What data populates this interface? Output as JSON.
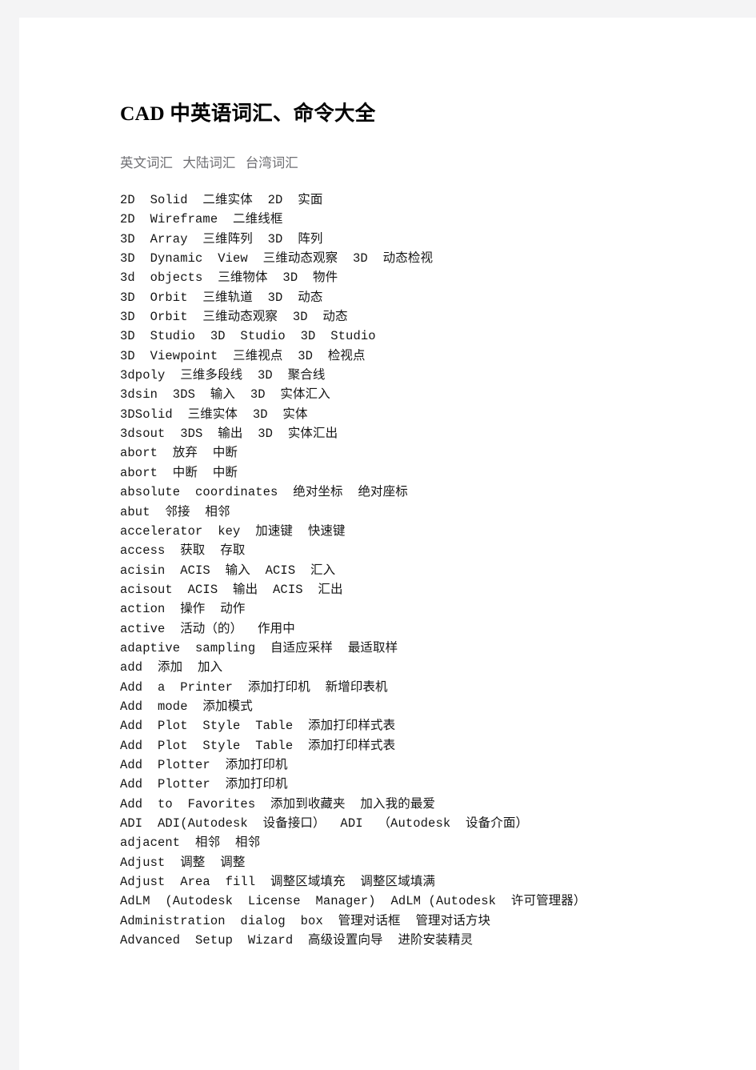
{
  "document": {
    "title": "CAD 中英语词汇、命令大全",
    "column_header": "英文词汇   大陆词汇   台湾词汇",
    "page_background": "#ffffff",
    "margin_background": "#f4f4f5",
    "title_color": "#000000",
    "header_color": "#6e6e72",
    "body_color": "#151515",
    "entries": [
      "2D  Solid  二维实体  2D  实面",
      "2D  Wireframe  二维线框",
      "3D  Array  三维阵列  3D  阵列",
      "3D  Dynamic  View  三维动态观察  3D  动态检视",
      "3d  objects  三维物体  3D  物件",
      "3D  Orbit  三维轨道  3D  动态",
      "3D  Orbit  三维动态观察  3D  动态",
      "3D  Studio  3D  Studio  3D  Studio",
      "3D  Viewpoint  三维视点  3D  检视点",
      "3dpoly  三维多段线  3D  聚合线",
      "3dsin  3DS  输入  3D  实体汇入",
      "3DSolid  三维实体  3D  实体",
      "3dsout  3DS  输出  3D  实体汇出",
      "abort  放弃  中断",
      "abort  中断  中断",
      "absolute  coordinates  绝对坐标  绝对座标",
      "abut  邻接  相邻",
      "accelerator  key  加速键  快速键",
      "access  获取  存取",
      "acisin  ACIS  输入  ACIS  汇入",
      "acisout  ACIS  输出  ACIS  汇出",
      "action  操作  动作",
      "active  活动（的）  作用中",
      "adaptive  sampling  自适应采样  最适取样",
      "add  添加  加入",
      "Add  a  Printer  添加打印机  新增印表机",
      "Add  mode  添加模式",
      "Add  Plot  Style  Table  添加打印样式表",
      "Add  Plot  Style  Table  添加打印样式表",
      "Add  Plotter  添加打印机",
      "Add  Plotter  添加打印机",
      "Add  to  Favorites  添加到收藏夹  加入我的最爱",
      "ADI  ADI(Autodesk  设备接口）  ADI  （Autodesk  设备介面）",
      "adjacent  相邻  相邻",
      "Adjust  调整  调整",
      "Adjust  Area  fill  调整区域填充  调整区域填满",
      "AdLM  (Autodesk  License  Manager)  AdLM (Autodesk  许可管理器）",
      "Administration  dialog  box  管理对话框  管理对话方块",
      "Advanced  Setup  Wizard  高级设置向导  进阶安装精灵"
    ]
  }
}
